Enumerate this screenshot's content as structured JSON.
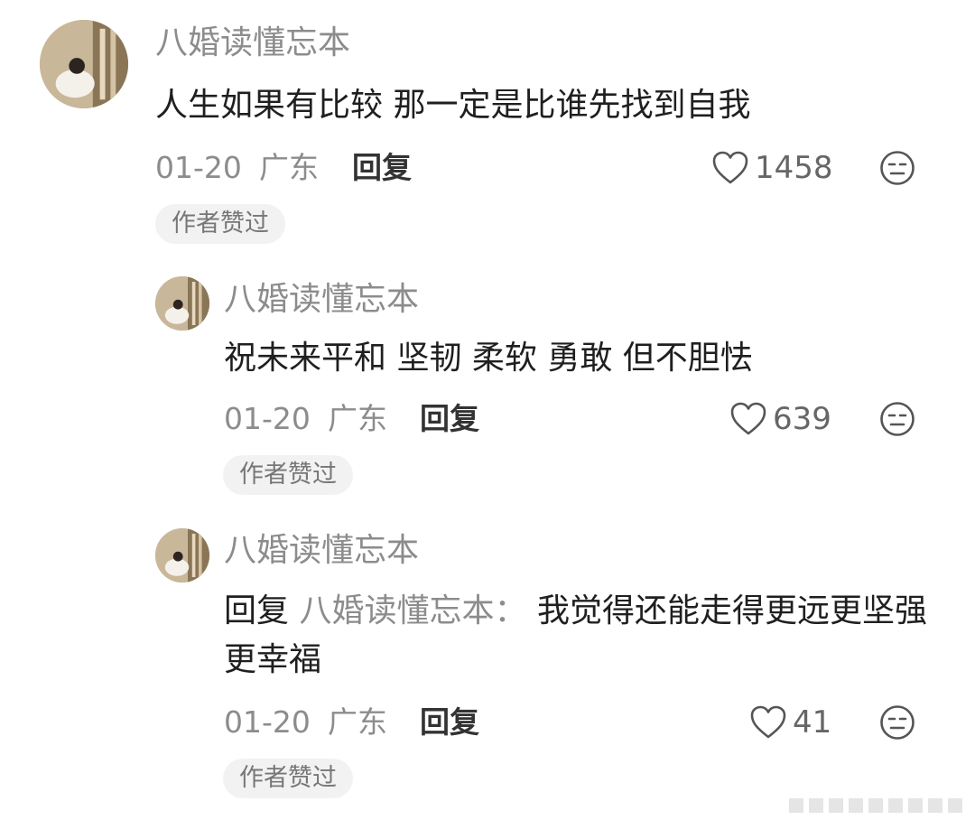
{
  "comments": [
    {
      "author": "八婚读懂忘本",
      "text": "人生如果有比较 那一定是比谁先找到自我",
      "date": "01-20",
      "location": "广东",
      "reply_label": "回复",
      "likes": "1458",
      "badge": "作者赞过"
    },
    {
      "author": "八婚读懂忘本",
      "text": "祝未来平和 坚韧 柔软 勇敢 但不胆怯",
      "date": "01-20",
      "location": "广东",
      "reply_label": "回复",
      "likes": "639",
      "badge": "作者赞过"
    },
    {
      "author": "八婚读懂忘本",
      "reply_prefix": "回复",
      "reply_target": "八婚读懂忘本：",
      "text": "我觉得还能走得更远更坚强更幸福",
      "date": "01-20",
      "location": "广东",
      "reply_label": "回复",
      "likes": "41",
      "badge": "作者赞过"
    }
  ],
  "icons": {
    "like": "heart-outline-icon",
    "dislike": "neutral-face-icon"
  },
  "colors": {
    "secondary_text": "#8c8c8c",
    "badge_bg": "#f2f2f2"
  }
}
